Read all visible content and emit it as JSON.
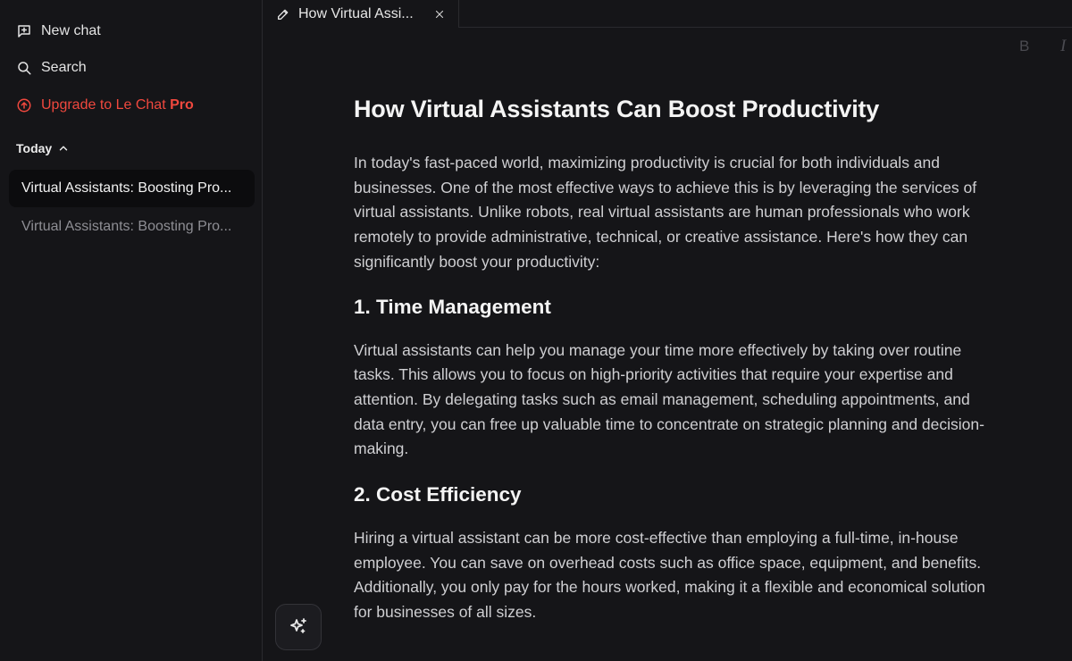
{
  "sidebar": {
    "new_chat": "New chat",
    "search": "Search",
    "upgrade_prefix": "Upgrade to Le Chat ",
    "upgrade_suffix": "Pro",
    "section": "Today",
    "history": [
      "Virtual Assistants: Boosting Pro...",
      "Virtual Assistants: Boosting Pro..."
    ]
  },
  "tab": {
    "title": "How Virtual Assi..."
  },
  "toolbar": {
    "bold": "B",
    "italic": "I"
  },
  "document": {
    "title": "How Virtual Assistants Can Boost Productivity",
    "intro": "In today's fast-paced world, maximizing productivity is crucial for both individuals and businesses. One of the most effective ways to achieve this is by leveraging the services of virtual assistants. Unlike robots, real virtual assistants are human professionals who work remotely to provide administrative, technical, or creative assistance. Here's how they can significantly boost your productivity:",
    "sections": [
      {
        "heading": "1. Time Management",
        "body": "Virtual assistants can help you manage your time more effectively by taking over routine tasks. This allows you to focus on high-priority activities that require your expertise and attention. By delegating tasks such as email management, scheduling appointments, and data entry, you can free up valuable time to concentrate on strategic planning and decision-making."
      },
      {
        "heading": "2. Cost Efficiency",
        "body": "Hiring a virtual assistant can be more cost-effective than employing a full-time, in-house employee. You can save on overhead costs such as office space, equipment, and benefits. Additionally, you only pay for the hours worked, making it a flexible and economical solution for businesses of all sizes."
      }
    ]
  },
  "colors": {
    "accent": "#f0483e",
    "background": "#151518"
  },
  "icons": {
    "new_chat": "new-chat-icon",
    "search": "search-icon",
    "upgrade": "arrow-up-circle-icon",
    "section_toggle": "chevron-up-icon",
    "tab_edit": "pencil-icon",
    "tab_close": "close-icon",
    "ai": "sparkles-icon"
  }
}
